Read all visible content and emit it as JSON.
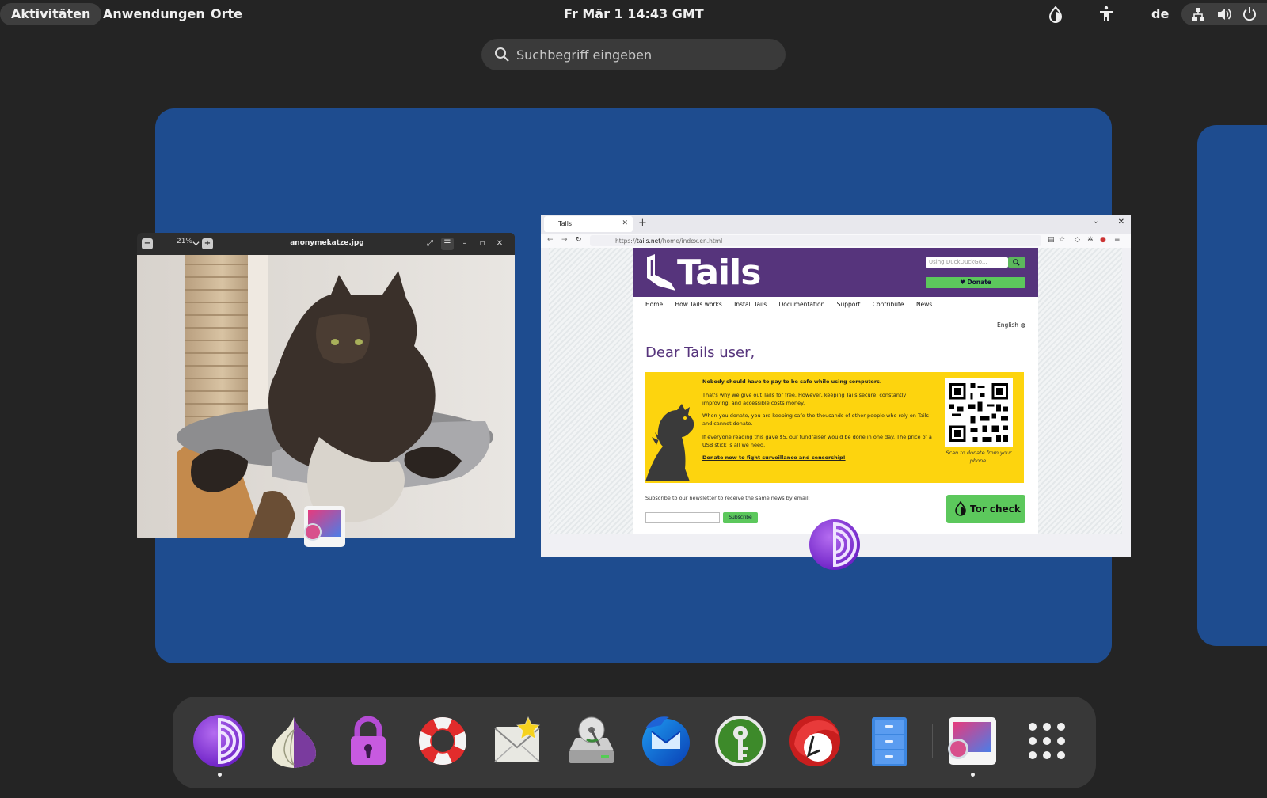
{
  "topbar": {
    "activities": "Aktivitäten",
    "applications": "Anwendungen",
    "places": "Orte",
    "clock": "Fr Mär 1  14:43 GMT",
    "language": "de",
    "icons": [
      "tor-status-icon",
      "accessibility-icon",
      "network-icon",
      "volume-icon",
      "power-icon"
    ]
  },
  "search": {
    "placeholder": "Suchbegriff eingeben"
  },
  "windows": {
    "image_viewer": {
      "zoom": "21%",
      "title": "anonymekatze.jpg"
    },
    "browser": {
      "tab_title": "Tails",
      "url_prefix": "https://",
      "url_host": "tails.net",
      "url_path": "/home/index.en.html",
      "page": {
        "logo": "Tails",
        "search_placeholder": "Using DuckDuckGo...",
        "donate_label": "♥ Donate",
        "nav": [
          "Home",
          "How Tails works",
          "Install Tails",
          "Documentation",
          "Support",
          "Contribute",
          "News"
        ],
        "language": "English",
        "greeting": "Dear Tails user,",
        "banner_paragraphs": [
          "Nobody should have to pay to be safe while using computers.",
          "That's why we give out Tails for free. However, keeping Tails secure, constantly improving, and accessible costs money.",
          "When you donate, you are keeping safe the thousands of other people who rely on Tails and cannot donate.",
          "If everyone reading this gave $5, our fundraiser would be done in one day. The price of a USB stick is all we need."
        ],
        "banner_link": "Donate now to fight surveillance and censorship!",
        "qr_caption": "Scan to donate from your phone.",
        "newsletter_text": "Subscribe to our newsletter to receive the same news by email:",
        "subscribe_label": "Subscribe",
        "tor_check_label": "Tor check"
      }
    }
  },
  "dash": {
    "items": [
      "tor-browser-icon",
      "onion-circuits-icon",
      "kleopatra-lock-icon",
      "help-lifebuoy-icon",
      "email-icon",
      "disk-utility-icon",
      "thunderbird-icon",
      "keepassxc-icon",
      "electrum-icon",
      "files-icon",
      "image-viewer-icon",
      "show-apps-icon"
    ]
  },
  "colors": {
    "workspace": "#1e4c8f",
    "tails_purple": "#56347c",
    "tails_yellow": "#fdd40e",
    "tails_green": "#5cc85c"
  }
}
